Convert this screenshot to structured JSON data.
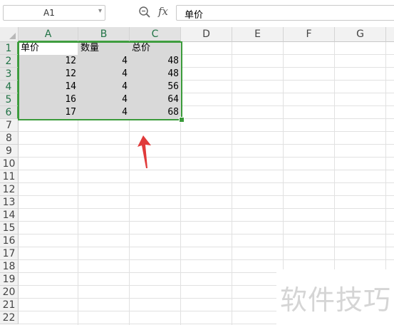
{
  "name_box": {
    "value": "A1",
    "dropdown_icon": "chevron-down-icon"
  },
  "formula_bar": {
    "zoom_icon": "zoom-formula-icon",
    "fx_label": "fx",
    "content": "单价"
  },
  "columns": [
    "A",
    "B",
    "C",
    "D",
    "E",
    "F",
    "G"
  ],
  "rows": [
    "1",
    "2",
    "3",
    "4",
    "5",
    "6",
    "7",
    "8",
    "9",
    "10",
    "11",
    "12",
    "13",
    "14",
    "15",
    "16",
    "17",
    "18",
    "19",
    "20",
    "21",
    "22"
  ],
  "cells": {
    "A1": "单价",
    "B1": "数量",
    "C1": "总价",
    "A2": "12",
    "B2": "4",
    "C2": "48",
    "A3": "12",
    "B3": "4",
    "C3": "48",
    "A4": "14",
    "B4": "4",
    "C4": "56",
    "A5": "16",
    "B5": "4",
    "C5": "64",
    "A6": "17",
    "B6": "4",
    "C6": "68"
  },
  "selection": {
    "range": "A1:C6",
    "color": "#3b9b3b",
    "fill": "#d9d9d9"
  },
  "annotation": {
    "arrow_color": "#e03a3a",
    "arrow_icon": "red-arrow-icon"
  },
  "watermark": "软件技巧"
}
